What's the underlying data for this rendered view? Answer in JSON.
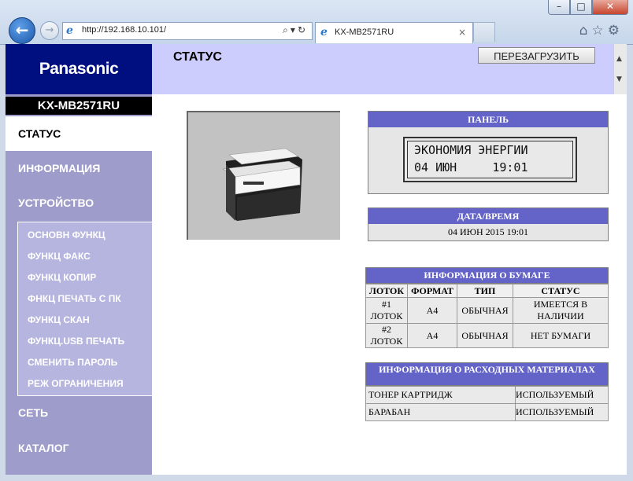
{
  "browser": {
    "window_buttons": {
      "minimize": "–",
      "maximize": "□",
      "close": "✕"
    },
    "address": "http://192.168.10.101/",
    "tab_title": "KX-MB2571RU"
  },
  "sidebar": {
    "brand": "Panasonic",
    "model": "KX-MB2571RU",
    "items": [
      {
        "label": "СТАТУС"
      },
      {
        "label": "ИНФОРМАЦИЯ"
      },
      {
        "label": "УСТРОЙСТВО"
      },
      {
        "label": "СЕТЬ"
      },
      {
        "label": "КАТАЛОГ"
      }
    ],
    "subitems": [
      {
        "label": "ОСНОВН ФУНКЦ"
      },
      {
        "label": "ФУНКЦ ФАКС"
      },
      {
        "label": "ФУНКЦ КОПИР"
      },
      {
        "label": "ФНКЦ ПЕЧАТЬ С ПК"
      },
      {
        "label": "ФУНКЦ СКАН"
      },
      {
        "label": "ФУНКЦ.USB ПЕЧАТЬ"
      },
      {
        "label": "СМЕНИТЬ ПАРОЛЬ"
      },
      {
        "label": "РЕЖ ОГРАНИЧЕНИЯ"
      }
    ]
  },
  "header": {
    "title": "СТАТУС",
    "reboot_label": "ПЕРЕЗАГРУЗИТЬ"
  },
  "panel": {
    "title": "ПАНЕЛЬ",
    "line1": "ЭКОНОМИЯ ЭНЕРГИИ",
    "line2": "04 ИЮН     19:01"
  },
  "datetime": {
    "title": "ДАТА/ВРЕМЯ",
    "value": "04 ИЮН 2015 19:01"
  },
  "paper": {
    "title": "ИНФОРМАЦИЯ О БУМАГЕ",
    "headers": [
      "ЛОТОК",
      "ФОРМАТ",
      "ТИП",
      "СТАТУС"
    ],
    "rows": [
      {
        "tray": "#1 ЛОТОК",
        "format": "A4",
        "type": "ОБЫЧНАЯ",
        "status": "ИМЕЕТСЯ В НАЛИЧИИ"
      },
      {
        "tray": "#2 ЛОТОК",
        "format": "A4",
        "type": "ОБЫЧНАЯ",
        "status": "НЕТ БУМАГИ"
      }
    ]
  },
  "consumables": {
    "title": "ИНФОРМАЦИЯ О РАСХОДНЫХ МАТЕРИАЛАХ",
    "rows": [
      {
        "name": "ТОНЕР КАРТРИДЖ",
        "status": "ИСПОЛЬЗУЕМЫЙ"
      },
      {
        "name": "БАРАБАН",
        "status": "ИСПОЛЬЗУЕМЫЙ"
      }
    ]
  },
  "colors": {
    "brand": "#000f80",
    "sidebar": "#9d9ccb",
    "header": "#ccccfd",
    "box_header": "#6464c8"
  }
}
